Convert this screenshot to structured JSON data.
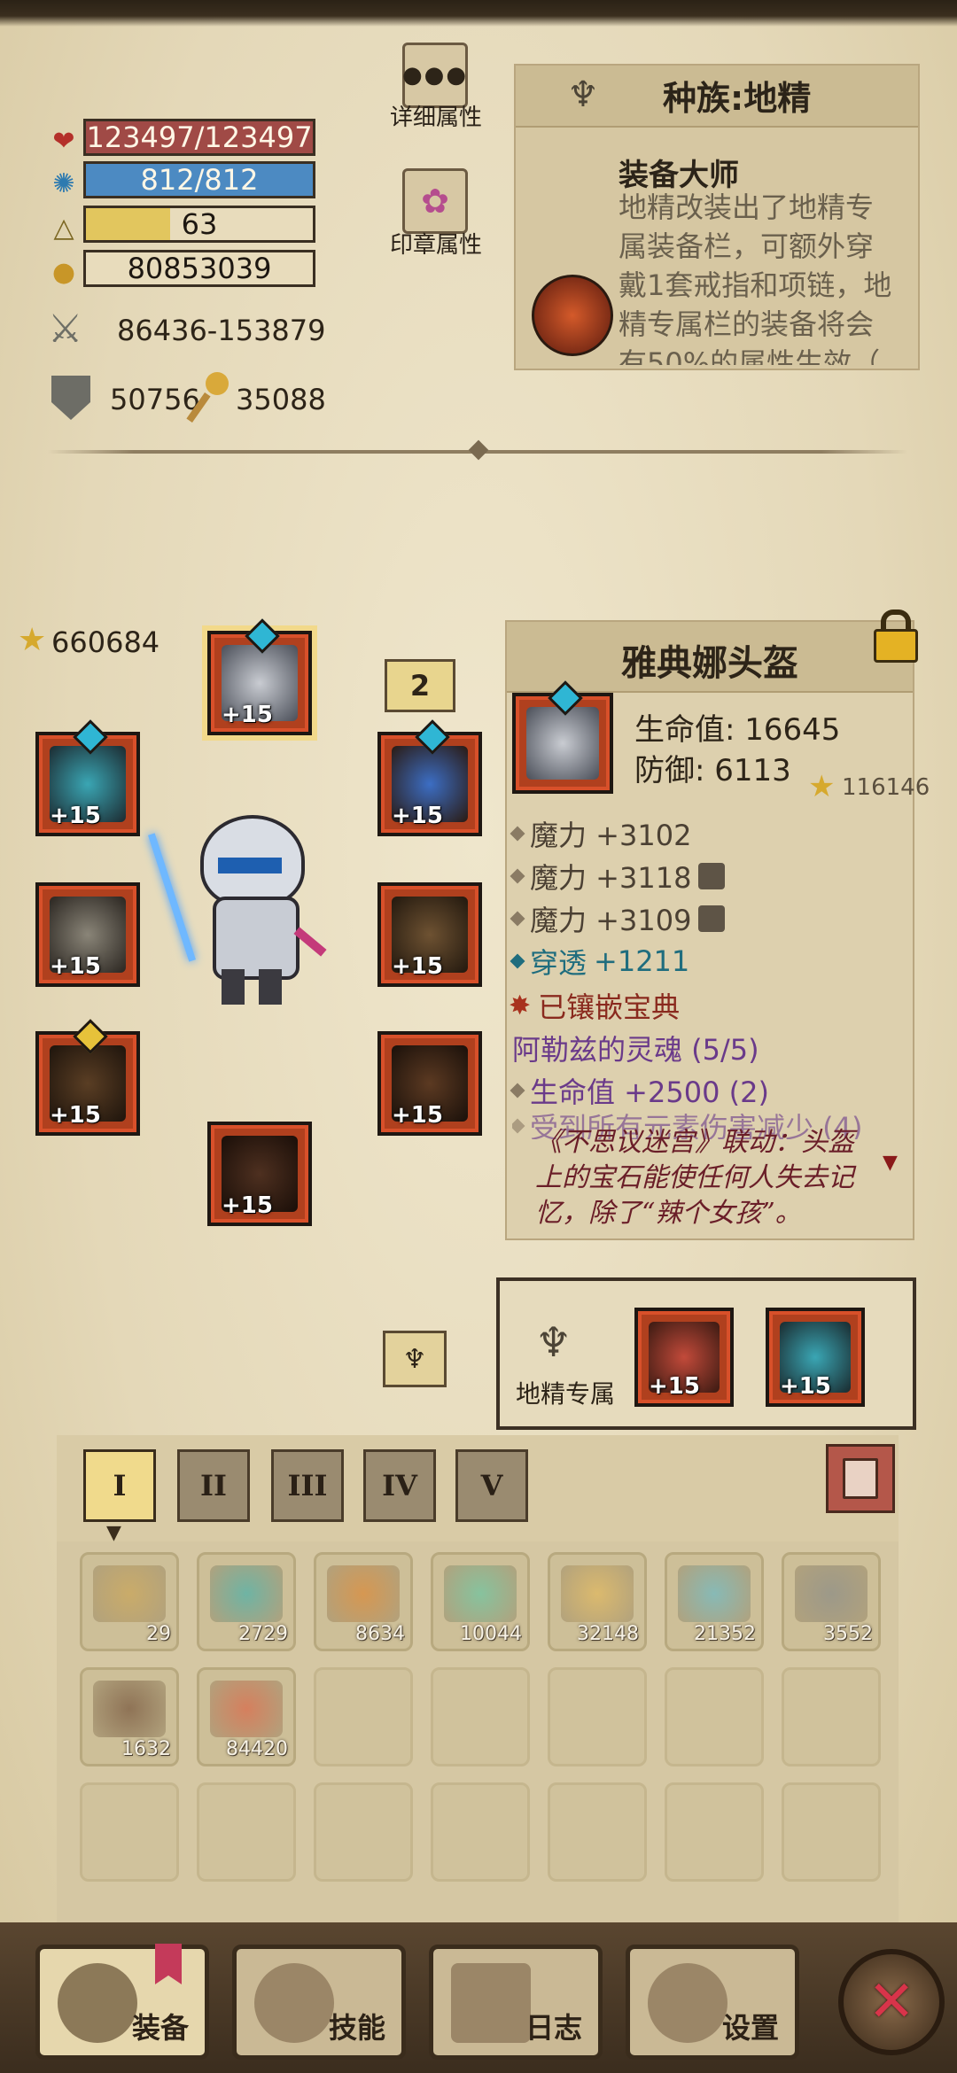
{
  "stats": {
    "hp": "123497/123497",
    "hp_fill": 1.0,
    "mp": "812/812",
    "mp_fill": 1.0,
    "level": "63",
    "level_fill": 0.37,
    "gold": "80853039",
    "attack": "86436-153879",
    "defense": "50756",
    "magic": "35088"
  },
  "buttons": {
    "detail_attr": "详细属性",
    "seal_attr": "印章属性"
  },
  "race_panel": {
    "title": "种族:地精",
    "trait_name": "装备大师",
    "trait_desc": "地精改装出了地精专属装备栏，可额外穿戴1套戒指和项链，地精专属栏的装备将会有50%的属性生效（"
  },
  "equipment": {
    "total_score": "660684",
    "page_badge": "2",
    "slot_level": "+15"
  },
  "item_detail": {
    "name": "雅典娜头盔",
    "hp": "生命值: 16645",
    "defense": "防御: 6113",
    "score": "116146",
    "attrs": [
      "魔力 +3102",
      "魔力 +3118",
      "魔力 +3109"
    ],
    "pierce_label": "穿透",
    "pierce_value": "+1211",
    "socketed": "已镶嵌宝典",
    "set_name": "阿勒兹的灵魂 (5/5)",
    "set_bonus_hp": "生命值 +2500 (2)",
    "set_bonus_dmg": "受到所有元素伤害减少 (4)",
    "flavor": "《不思议迷宫》联动：头盔上的宝石能使任何人失去记忆，除了“辣个女孩”。"
  },
  "goblin_exclusive": {
    "label": "地精专属",
    "slot1_level": "+15",
    "slot2_level": "+15"
  },
  "tabs": [
    "I",
    "II",
    "III",
    "IV",
    "V"
  ],
  "inventory": [
    {
      "count": "29",
      "color": "#c9a55a"
    },
    {
      "count": "2729",
      "color": "#4fb0a8"
    },
    {
      "count": "8634",
      "color": "#d98a3a"
    },
    {
      "count": "10044",
      "color": "#6fc4a0"
    },
    {
      "count": "32148",
      "color": "#e0b860"
    },
    {
      "count": "21352",
      "color": "#70b8c0"
    },
    {
      "count": "3552",
      "color": "#8c8c84"
    },
    {
      "count": "1632",
      "color": "#7a5a40"
    },
    {
      "count": "84420",
      "color": "#d86a4a"
    }
  ],
  "nav": {
    "equip": "装备",
    "skill": "技能",
    "log": "日志",
    "settings": "设置"
  }
}
